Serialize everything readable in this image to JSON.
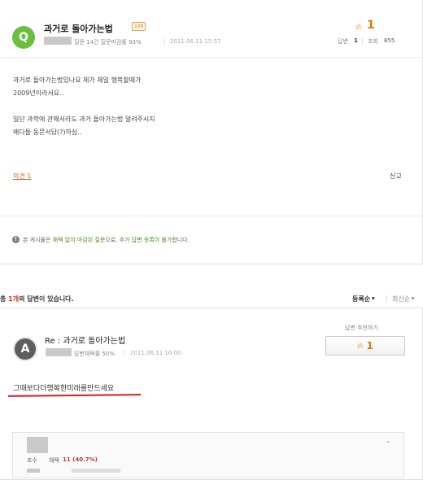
{
  "question": {
    "avatar_letter": "Q",
    "title": "과거로 돌아가는법",
    "badge": "100",
    "meta_stats": "질문 14건 질문마감률 93%",
    "date": "2011.06.11 15:57",
    "like_count": "1",
    "answer_label": "답변",
    "answer_count": "1",
    "view_label": "조회",
    "view_count": "855",
    "body_lines": [
      "과거로 돌아가는법있나요 제가 제일 행복할때가",
      "2009년이라서요..",
      "",
      "일단 과학에 관해서라도 과거 돌아가는법 알려주시지",
      "왜다들 동문서답(?)하심.."
    ],
    "opinion_link": "의견 1",
    "report_label": "신고",
    "notice_prefix": "본 게시물은 ",
    "notice_green_1": "채택 없이 마감된 질문",
    "notice_mid": "으로, ",
    "notice_green_2": "추가 답변 등록이 불가",
    "notice_suffix": "합니다."
  },
  "answers_header": {
    "prefix": "총 ",
    "count": "1개",
    "suffix": "의 답변이 있습니다.",
    "sort_registered": "등록순",
    "sort_latest": "최신순"
  },
  "answer": {
    "avatar_letter": "A",
    "title": "Re : 과거로 돌아가는법",
    "meta_stats": "답변채택률 50%",
    "date": "2011.06.11 16:00",
    "recommend_label": "답변 추천하기",
    "recommend_count": "1",
    "body": "그때보다더행복한미래를만드세요",
    "profile_grade_prefix": "초수",
    "profile_adopt_label": "채택",
    "profile_adopt_value": "11 (40.7%)"
  },
  "colors": {
    "q_avatar": "#6cbf3c",
    "a_avatar": "#5e5e5e",
    "accent_orange": "#e07a00",
    "link_green": "#4a8c2a",
    "underline_red": "#d21f1f"
  }
}
